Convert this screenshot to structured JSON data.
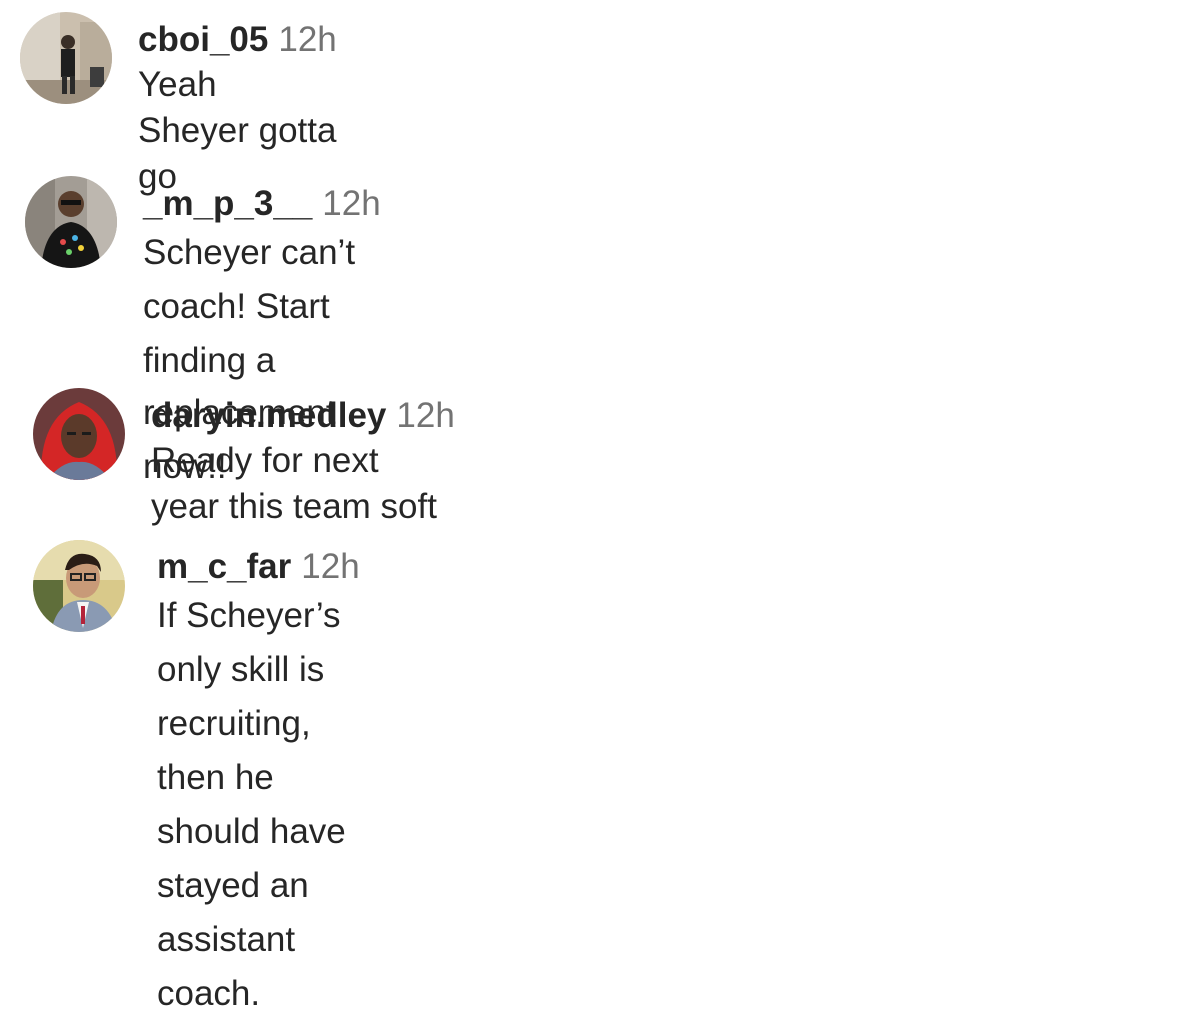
{
  "comments": [
    {
      "username": "cboi_05",
      "time": "12h",
      "lines": [
        "Yeah Sheyer gotta go"
      ]
    },
    {
      "username": "_m_p_3__",
      "time": "12h",
      "lines": [
        "Scheyer can’t coach! Start finding a",
        "replacement now!!"
      ]
    },
    {
      "username": "daryin.medley",
      "time": "12h",
      "lines": [
        "Ready for next year this team soft"
      ]
    },
    {
      "username": "m_c_far",
      "time": "12h",
      "lines": [
        "If Scheyer’s only skill is recruiting,",
        "then he should have stayed an",
        "assistant coach."
      ]
    }
  ]
}
